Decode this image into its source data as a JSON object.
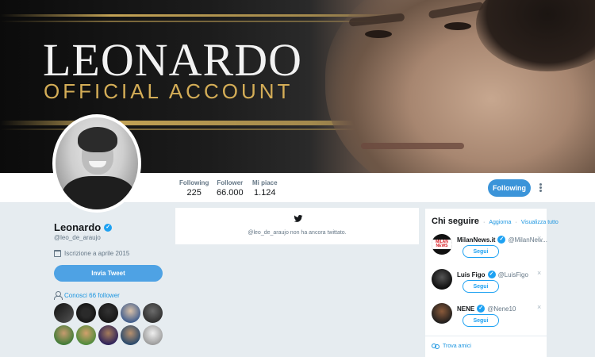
{
  "banner": {
    "title": "LEONARDO",
    "subtitle": "OFFICIAL ACCOUNT"
  },
  "stats": [
    {
      "label": "Following",
      "value": "225"
    },
    {
      "label": "Follower",
      "value": "66.000"
    },
    {
      "label": "Mi piace",
      "value": "1.124"
    }
  ],
  "actions": {
    "following_label": "Following",
    "more_icon": "ellipsis-vertical-icon"
  },
  "profile": {
    "name": "Leonardo",
    "handle": "@leo_de_araujo",
    "joined": "Iscrizione a aprile 2015",
    "tweet_button": "Invia Tweet",
    "known_followers": "Conosci 66 follower",
    "verified_icon": "verified-badge-icon"
  },
  "timeline": {
    "message": "@leo_de_araujo non ha ancora twittato.",
    "icon": "twitter-bird-icon"
  },
  "who_to_follow": {
    "title": "Chi seguire",
    "separator": "·",
    "refresh": "Aggiorna",
    "view_all": "Visualizza tutto",
    "find_friends": "Trova amici",
    "suggestions": [
      {
        "name": "MilanNews.it",
        "handle": "@MilanNew...",
        "button": "Segui",
        "verified": true,
        "avatar_text": "MILAN NEWS"
      },
      {
        "name": "Luis Figo",
        "handle": "@LuisFigo",
        "button": "Segui",
        "verified": true,
        "avatar_text": ""
      },
      {
        "name": "NENE",
        "handle": "@Nene10",
        "button": "Segui",
        "verified": true,
        "avatar_text": ""
      }
    ]
  },
  "colors": {
    "accent": "#1da1f2",
    "follow_button": "#3b94d9",
    "page_bg": "#e6ecf0",
    "gold": "#d4ad57"
  }
}
